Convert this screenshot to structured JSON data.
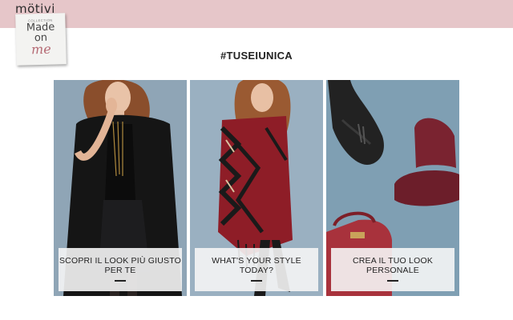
{
  "header": {
    "brand": "mötivi",
    "badge": {
      "small": "COLLECTION",
      "line1": "Made",
      "line2": "on",
      "line3": "me"
    },
    "background_color": "#e6c6c9"
  },
  "main": {
    "hashtag": "#TUSEIUNICA",
    "cards": [
      {
        "caption": "SCOPRI IL LOOK PIÙ GIUSTO PER TE"
      },
      {
        "caption": "WHAT'S YOUR STYLE TODAY?"
      },
      {
        "caption": "CREA IL TUO LOOK PERSONALE"
      }
    ]
  },
  "colors": {
    "photo_background": "#8fa6b8",
    "accent_burgundy": "#7a2330"
  }
}
